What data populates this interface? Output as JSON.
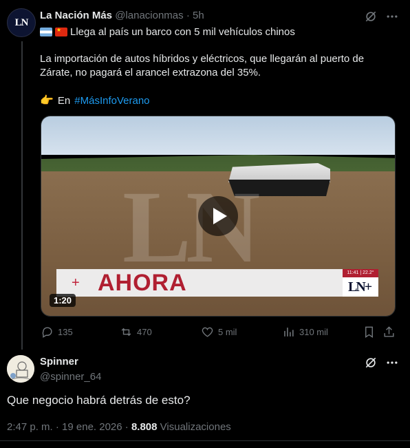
{
  "tweet": {
    "avatar_text": "LN",
    "author_name": "La Nación Más",
    "author_handle": "@lanacionmas",
    "time": "· 5h",
    "headline": "Llega al país un barco con 5 mil vehículos chinos",
    "body": "La importación de autos híbridos y eléctricos, que llegarán al puerto de Zárate, no pagará el arancel extrazona del 35%.",
    "hash_prefix": "En",
    "hashtag": "#MásInfoVerano",
    "video": {
      "banner_text": "AHORA",
      "banner_time": "11:41 | 22.2°",
      "channel_mark": "LN+",
      "duration": "1:20"
    },
    "stats": {
      "replies": "135",
      "reposts": "470",
      "likes": "5 mil",
      "views": "310 mil"
    }
  },
  "reply": {
    "author_name": "Spinner",
    "author_handle": "@spinner_64",
    "text": "Que negocio habrá detrás de esto?",
    "timestamp": "2:47 p. m. · 19 ene. 2026 · ",
    "views_count": "8.808",
    "views_label": " Visualizaciones"
  },
  "icons": {
    "grok": "grok-icon",
    "more": "more-icon",
    "reply": "reply-icon",
    "repost": "repost-icon",
    "like": "like-icon",
    "views": "views-icon",
    "bookmark": "bookmark-icon",
    "share": "share-icon"
  },
  "colors": {
    "background": "#000000",
    "text": "#e7e9ea",
    "secondary": "#71767b",
    "link": "#1d9bf0",
    "banner_red": "#b01f31"
  }
}
